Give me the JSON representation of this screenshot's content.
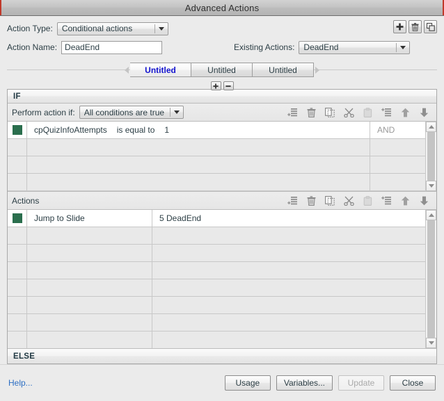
{
  "window": {
    "title": "Advanced Actions"
  },
  "form": {
    "action_type_label": "Action Type:",
    "action_type_value": "Conditional actions",
    "action_name_label": "Action Name:",
    "action_name_value": "DeadEnd",
    "existing_actions_label": "Existing Actions:",
    "existing_actions_value": "DeadEnd"
  },
  "top_buttons": [
    {
      "name": "add-action-button",
      "icon": "plus-icon"
    },
    {
      "name": "delete-action-button",
      "icon": "trash-icon"
    },
    {
      "name": "duplicate-action-button",
      "icon": "duplicate-icon"
    }
  ],
  "tabs": {
    "items": [
      {
        "label": "Untitled",
        "active": true
      },
      {
        "label": "Untitled",
        "active": false
      },
      {
        "label": "Untitled",
        "active": false
      }
    ],
    "add_label": "+",
    "remove_label": "-"
  },
  "if_panel": {
    "band_label": "IF",
    "perform_label": "Perform action if:",
    "perform_value": "All conditions are true",
    "conditions": [
      {
        "variable": "cpQuizInfoAttempts",
        "operator": "is equal to",
        "value": "1",
        "conjunction": "AND"
      }
    ],
    "empty_rows": 3
  },
  "actions_panel": {
    "band_label": "Actions",
    "rows": [
      {
        "action": "Jump to Slide",
        "target": "5 DeadEnd"
      }
    ],
    "empty_rows": 7
  },
  "else_panel": {
    "band_label": "ELSE"
  },
  "toolbar_icons": [
    {
      "name": "add-row-icon",
      "disabled": false
    },
    {
      "name": "delete-row-icon",
      "disabled": false
    },
    {
      "name": "copy-row-icon",
      "disabled": false
    },
    {
      "name": "cut-row-icon",
      "disabled": false
    },
    {
      "name": "paste-row-icon",
      "disabled": true
    },
    {
      "name": "insert-row-icon",
      "disabled": false
    },
    {
      "name": "move-up-icon",
      "disabled": false
    },
    {
      "name": "move-down-icon",
      "disabled": false
    }
  ],
  "footer": {
    "help_label": "Help...",
    "usage_label": "Usage",
    "variables_label": "Variables...",
    "update_label": "Update",
    "close_label": "Close"
  },
  "colors": {
    "marker_green": "#2a6e4d",
    "active_tab_blue": "#1414cf",
    "help_link_blue": "#2d6fc4",
    "window_bg": "#ebebeb"
  }
}
